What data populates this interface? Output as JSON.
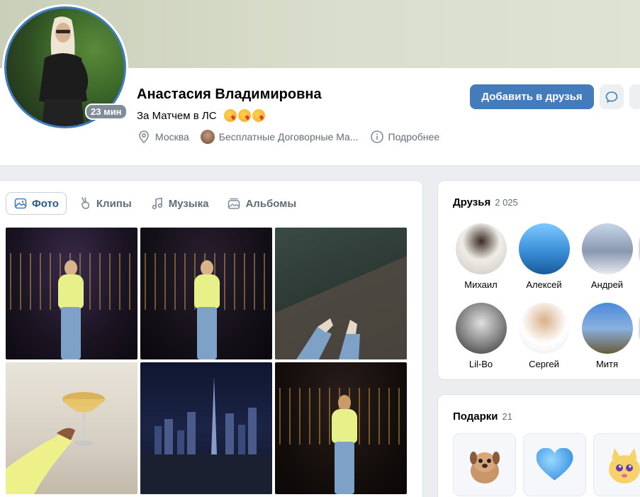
{
  "profile": {
    "name": "Анастасия Владимировна",
    "status_text": "За Матчем в ЛС",
    "online_badge": "23 мин",
    "city": "Москва",
    "community": "Бесплатные Договорные Ма...",
    "more_info": "Подробнее"
  },
  "actions": {
    "add_friend": "Добавить в друзья"
  },
  "tabs": [
    {
      "label": "Фото",
      "icon": "image-icon",
      "active": true
    },
    {
      "label": "Клипы",
      "icon": "clips-icon",
      "active": false
    },
    {
      "label": "Музыка",
      "icon": "music-icon",
      "active": false
    },
    {
      "label": "Альбомы",
      "icon": "albums-icon",
      "active": false
    }
  ],
  "friends": {
    "title": "Друзья",
    "count": "2 025",
    "items": [
      {
        "name": "Михаил"
      },
      {
        "name": "Алексей"
      },
      {
        "name": "Андрей"
      },
      {
        "name": "Lil-Bo"
      },
      {
        "name": "Сергей"
      },
      {
        "name": "Митя"
      }
    ]
  },
  "gifts": {
    "title": "Подарки",
    "count": "21"
  },
  "colors": {
    "primary_button": "#447bba",
    "avatar_ring": "#3f7bbf",
    "secondary_text": "#626d7a"
  }
}
